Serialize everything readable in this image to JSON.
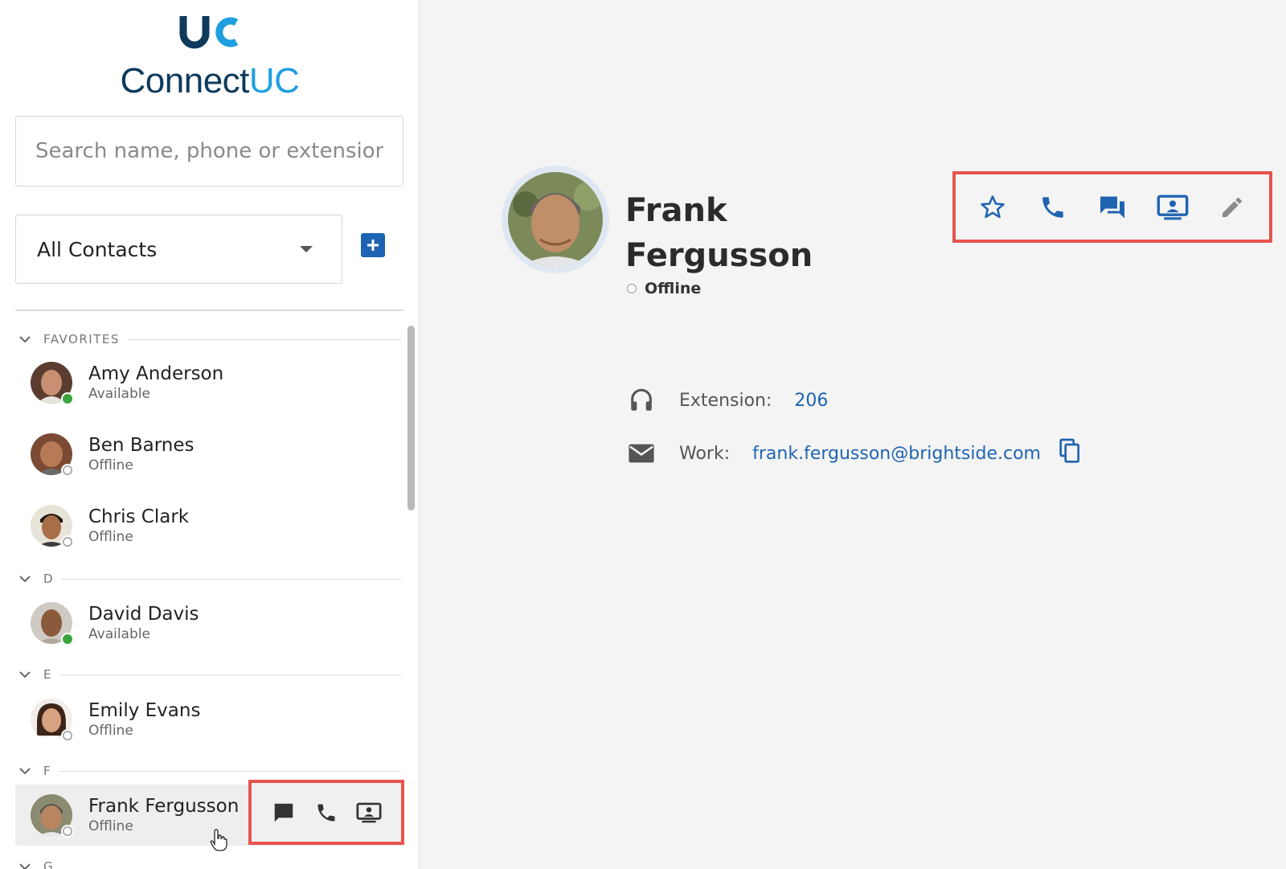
{
  "app": {
    "brand_prefix": "Connect",
    "brand_suffix": "UC"
  },
  "search": {
    "placeholder": "Search name, phone or extension"
  },
  "filter": {
    "selected": "All Contacts"
  },
  "groups": [
    {
      "label": "FAVORITES"
    },
    {
      "label": "D"
    },
    {
      "label": "E"
    },
    {
      "label": "F"
    },
    {
      "label": "G"
    }
  ],
  "contacts": [
    {
      "name": "Amy Anderson",
      "status": "Available"
    },
    {
      "name": "Ben Barnes",
      "status": "Offline"
    },
    {
      "name": "Chris Clark",
      "status": "Offline"
    },
    {
      "name": "David Davis",
      "status": "Available"
    },
    {
      "name": "Emily Evans",
      "status": "Offline"
    },
    {
      "name": "Frank Fergusson",
      "status": "Offline"
    }
  ],
  "detail": {
    "name": "Frank Fergusson",
    "status": "Offline",
    "extension_label": "Extension:",
    "extension_value": "206",
    "work_label": "Work:",
    "work_email": "frank.fergusson@brightside.com"
  },
  "colors": {
    "accent": "#1d63b3",
    "available": "#3aa53f",
    "highlight_border": "#e8534f"
  },
  "icons": {
    "action_bar": [
      "star-icon",
      "phone-icon",
      "chat-icon",
      "screen-share-icon",
      "edit-icon"
    ],
    "hover_actions": [
      "chat-icon",
      "phone-icon",
      "screen-share-icon"
    ]
  }
}
